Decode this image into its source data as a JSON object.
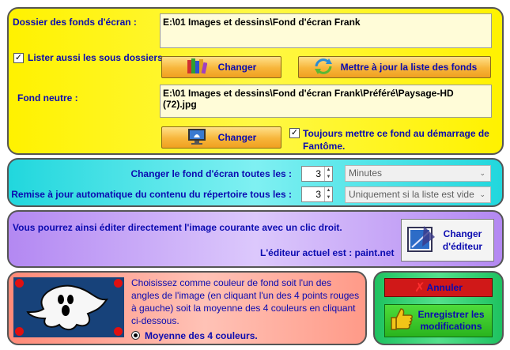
{
  "wallpaper": {
    "folder_label": "Dossier des fonds d'écran :",
    "folder_value": "E:\\01 Images et dessins\\Fond d'écran Frank",
    "subfolders_label": "Lister aussi les sous dossiers.",
    "subfolders_checked": "✓",
    "change_folder_label": "Changer",
    "refresh_label": "Mettre à jour la liste des fonds",
    "neutral_label": "Fond neutre :",
    "neutral_value": "E:\\01 Images et dessins\\Fond d'écran Frank\\Préféré\\Paysage-HD (72).jpg",
    "change_neutral_label": "Changer",
    "startup_label": "Toujours mettre ce fond au démarrage de Fantôme.",
    "startup_checked": "✓"
  },
  "timing": {
    "change_every_label": "Changer le fond d'écran toutes les :",
    "change_every_value": "3",
    "change_every_unit": "Minutes",
    "refresh_every_label": "Remise à jour automatique du contenu du répertoire tous les :",
    "refresh_every_value": "3",
    "refresh_every_unit": "Uniquement si la liste est vide"
  },
  "editor": {
    "info": "Vous pourrez ainsi éditer directement l'image courante avec un clic droit.",
    "current_label": "L'éditeur actuel est : paint.net",
    "change_editor_label": "Changer d'éditeur"
  },
  "background": {
    "description": "Choisissez comme couleur de fond soit l'un des angles de l'image (en cliquant l'un des 4 points rouges à gauche) soit la moyenne des 4 couleurs en cliquant ci-dessous.",
    "average_label": "Moyenne des 4 couleurs.",
    "preview_color": "#17427a",
    "dot_color": "#e01010"
  },
  "actions": {
    "cancel_label": "Annuler",
    "save_label": "Enregistrer les modifications"
  }
}
